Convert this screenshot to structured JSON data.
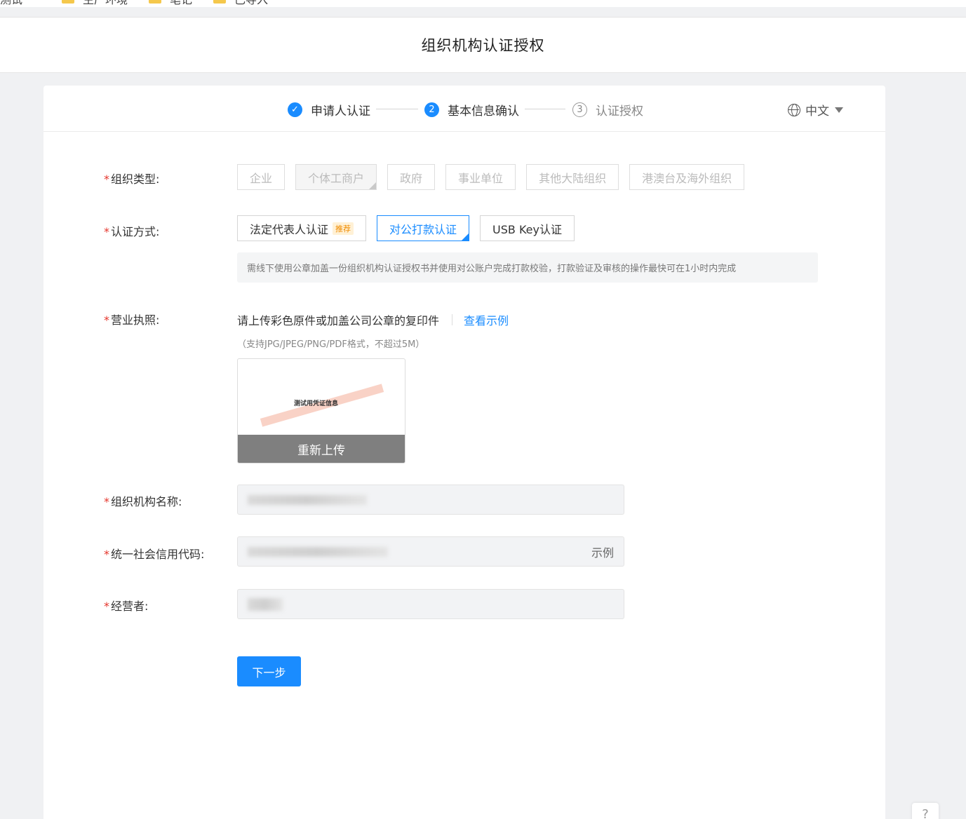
{
  "bookmarks": [
    "测试",
    "生产环境",
    "笔记",
    "已导入"
  ],
  "header": {
    "title": "组织机构认证授权"
  },
  "steps": [
    {
      "label": "申请人认证",
      "state": "done",
      "mark": "✓"
    },
    {
      "label": "基本信息确认",
      "state": "active",
      "mark": "2"
    },
    {
      "label": "认证授权",
      "state": "todo",
      "mark": "3"
    }
  ],
  "language": {
    "selected": "中文"
  },
  "form": {
    "org_type": {
      "label": "组织类型:",
      "options": [
        "企业",
        "个体工商户",
        "政府",
        "事业单位",
        "其他大陆组织",
        "港澳台及海外组织"
      ],
      "selected": "个体工商户"
    },
    "auth_method": {
      "label": "认证方式:",
      "options": [
        "法定代表人认证",
        "对公打款认证",
        "USB Key认证"
      ],
      "recommend_badge": "推荐",
      "selected": "对公打款认证",
      "note": "需线下使用公章加盖一份组织机构认证授权书并使用对公账户完成打款校验，打款验证及审核的操作最快可在1小时内完成"
    },
    "license": {
      "label": "营业执照:",
      "tip": "请上传彩色原件或加盖公司公章的复印件",
      "example_link": "查看示例",
      "sub": "（支持JPG/JPEG/PNG/PDF格式，不超过5M）",
      "thumb_text": "测试用凭证信息",
      "reupload": "重新上传"
    },
    "org_name": {
      "label": "组织机构名称:"
    },
    "credit_code": {
      "label": "统一社会信用代码:",
      "suffix": "示例"
    },
    "operator": {
      "label": "经营者:"
    },
    "next": "下一步"
  },
  "help": "?"
}
